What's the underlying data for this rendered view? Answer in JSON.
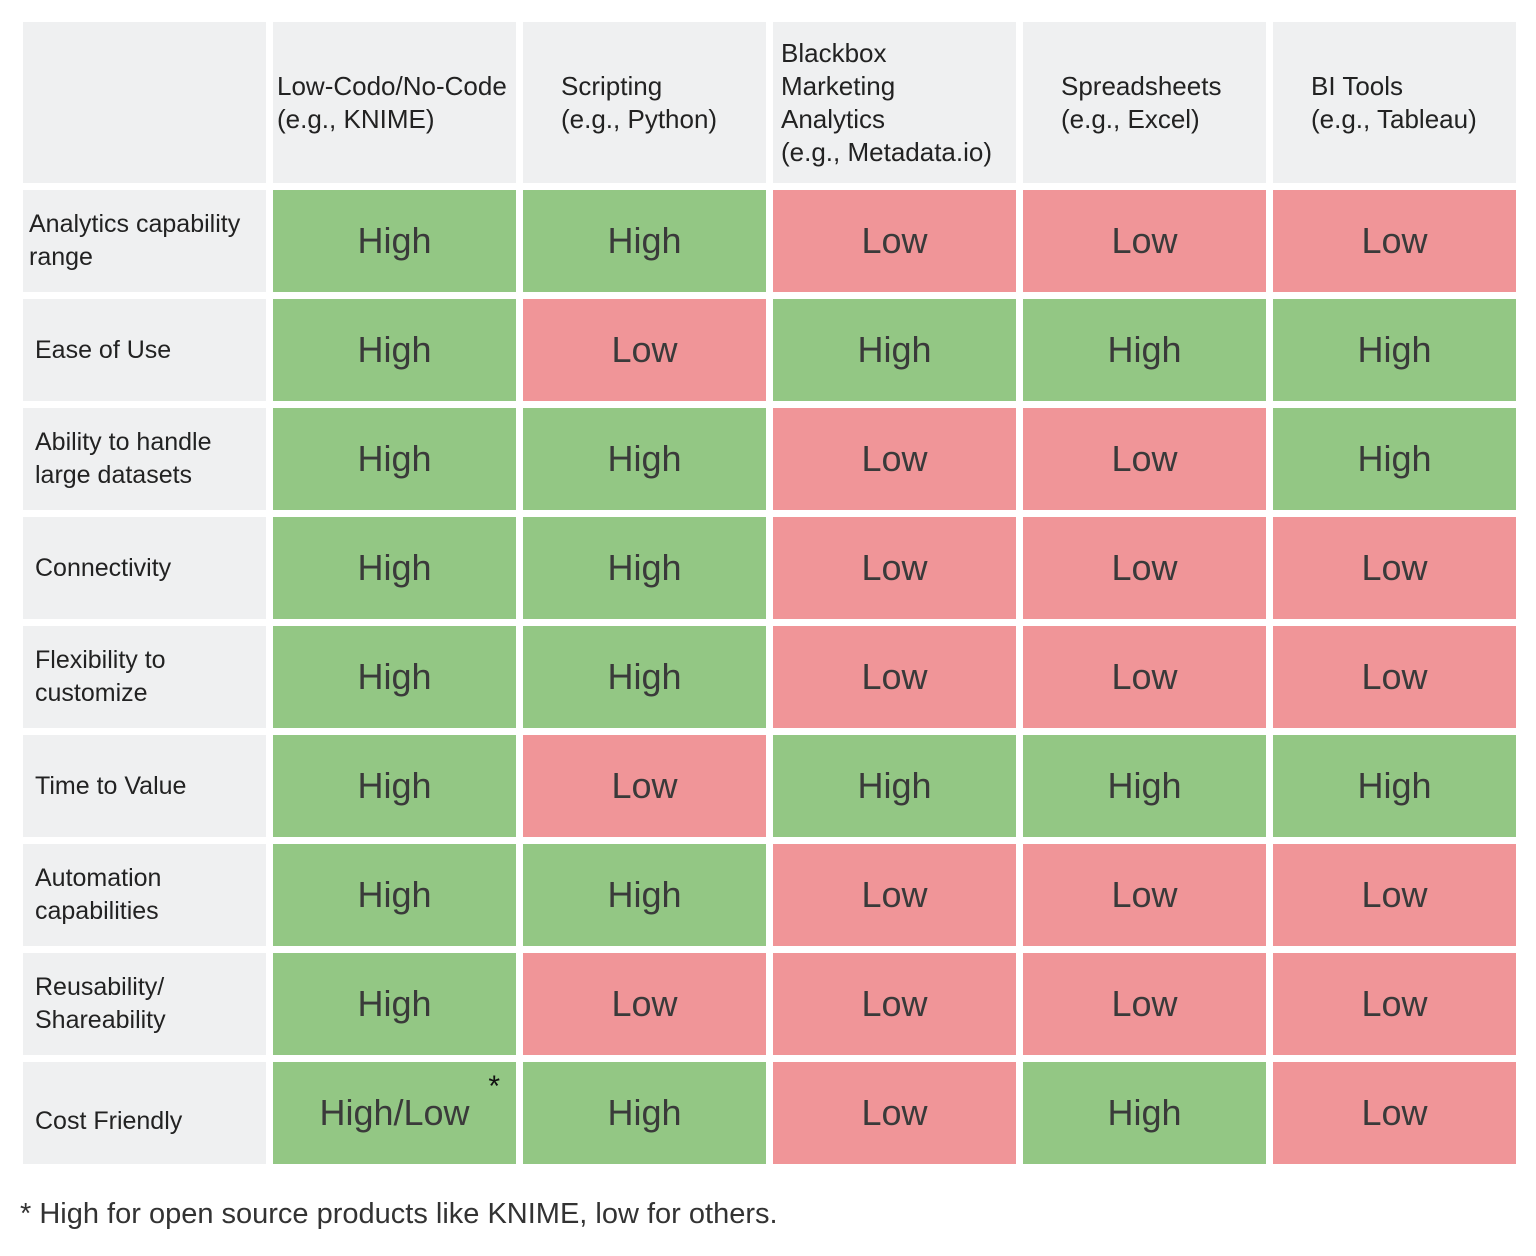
{
  "colors": {
    "high": "#93c784",
    "low": "#f09598",
    "header": "#eff0f1"
  },
  "columns": [
    "",
    "Low-Codo/No-Code\n(e.g., KNIME)",
    "Scripting\n(e.g., Python)",
    "Blackbox\nMarketing\nAnalytics\n(e.g., Metadata.io)",
    "Spreadsheets\n(e.g., Excel)",
    "BI Tools\n(e.g., Tableau)"
  ],
  "rows": [
    {
      "label": "Analytics capability range",
      "values": [
        "High",
        "High",
        "Low",
        "Low",
        "Low"
      ]
    },
    {
      "label": "Ease of Use",
      "values": [
        "High",
        "Low",
        "High",
        "High",
        "High"
      ]
    },
    {
      "label": "Ability to handle large datasets",
      "values": [
        "High",
        "High",
        "Low",
        "Low",
        "High"
      ]
    },
    {
      "label": "Connectivity",
      "values": [
        "High",
        "High",
        "Low",
        "Low",
        "Low"
      ]
    },
    {
      "label": "Flexibility to customize",
      "values": [
        "High",
        "High",
        "Low",
        "Low",
        "Low"
      ]
    },
    {
      "label": "Time to Value",
      "values": [
        "High",
        "Low",
        "High",
        "High",
        "High"
      ]
    },
    {
      "label": "Automation capabilities",
      "values": [
        "High",
        "High",
        "Low",
        "Low",
        "Low"
      ]
    },
    {
      "label": "Reusability/ Shareability",
      "values": [
        "High",
        "Low",
        "Low",
        "Low",
        "Low"
      ]
    },
    {
      "label": "Cost Friendly",
      "values": [
        "High/Low",
        "High",
        "Low",
        "High",
        "Low"
      ]
    }
  ],
  "footnote_marker": "*",
  "footnote": "* High for open source products like KNIME, low for others."
}
